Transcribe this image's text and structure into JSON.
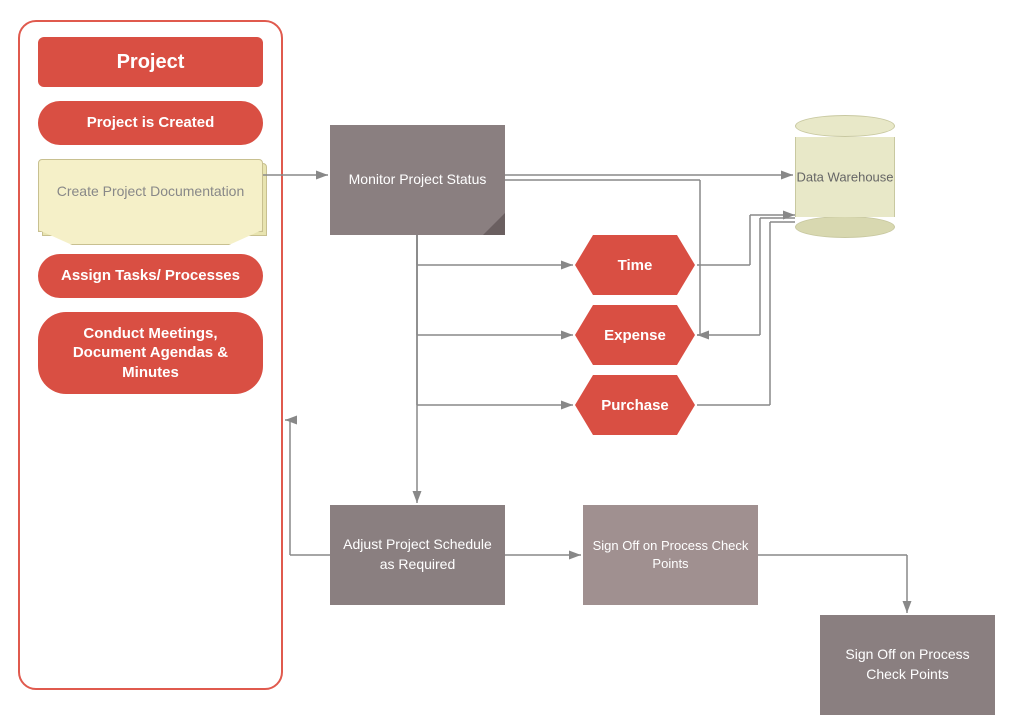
{
  "left_panel": {
    "title": "Project",
    "items": [
      {
        "id": "project-created",
        "label": "Project is Created",
        "type": "pill"
      },
      {
        "id": "create-docs",
        "label": "Create Project Documentation",
        "type": "doc"
      },
      {
        "id": "assign-tasks",
        "label": "Assign Tasks/ Processes",
        "type": "pill"
      },
      {
        "id": "conduct-meetings",
        "label": "Conduct Meetings, Document Agendas & Minutes",
        "type": "pill"
      }
    ]
  },
  "nodes": {
    "monitor": "Monitor Project Status",
    "data_warehouse": "Data Warehouse",
    "time": "Time",
    "expense": "Expense",
    "purchase": "Purchase",
    "adjust": "Adjust Project Schedule as Required",
    "signoff1": "Sign Off on Process Check Points",
    "signoff2": "Sign Off on Process Check Points"
  },
  "colors": {
    "red": "#d94f43",
    "gray_dark": "#8a7f80",
    "gray_medium": "#a09090",
    "cream": "#e8e8c8",
    "panel_border": "#e05a4e"
  }
}
